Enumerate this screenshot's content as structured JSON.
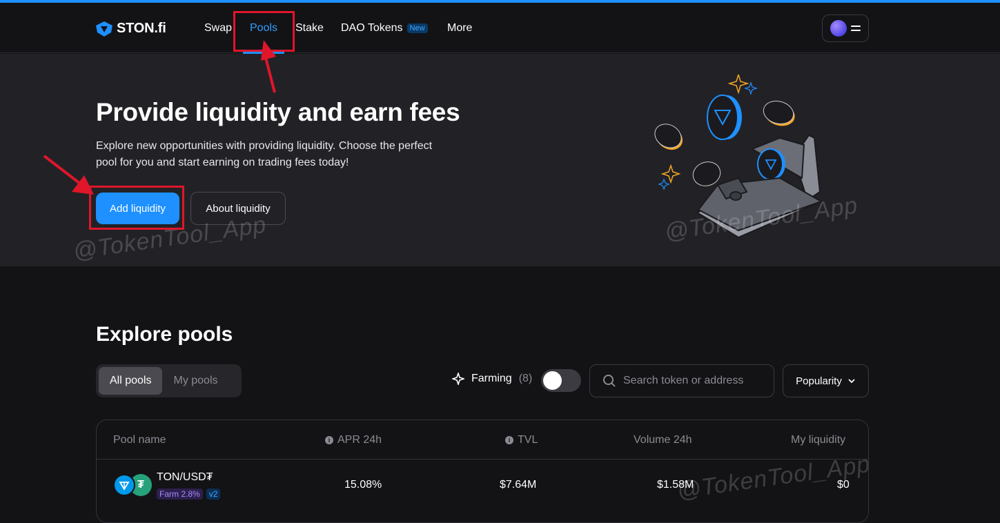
{
  "nav": {
    "logo_text": "STON.fi",
    "links": [
      "Swap",
      "Pools",
      "Stake",
      "DAO Tokens",
      "More"
    ],
    "new_badge": "New"
  },
  "hero": {
    "title": "Provide liquidity and earn fees",
    "subtitle": "Explore new opportunities with providing liquidity. Choose the perfect pool for you and start earning on trading fees today!",
    "primary_button": "Add liquidity",
    "secondary_button": "About liquidity"
  },
  "watermark": "@TokenTool_App",
  "explore": {
    "title": "Explore pools",
    "tabs": [
      "All pools",
      "My pools"
    ],
    "farming_label": "Farming",
    "farming_count": "(8)",
    "search_placeholder": "Search token or address",
    "sort_label": "Popularity"
  },
  "table": {
    "headers": [
      "Pool name",
      "APR 24h",
      "TVL",
      "Volume 24h",
      "My liquidity"
    ],
    "rows": [
      {
        "pair": "TON/USD₮",
        "farm_tag": "Farm 2.8%",
        "version_tag": "v2",
        "apr": "15.08%",
        "tvl": "$7.64M",
        "volume": "$1.58M",
        "my_liquidity": "$0"
      }
    ]
  },
  "colors": {
    "accent": "#1e90ff",
    "background": "#131316",
    "hero_background": "#222226",
    "annotation_red": "#e0162b"
  }
}
